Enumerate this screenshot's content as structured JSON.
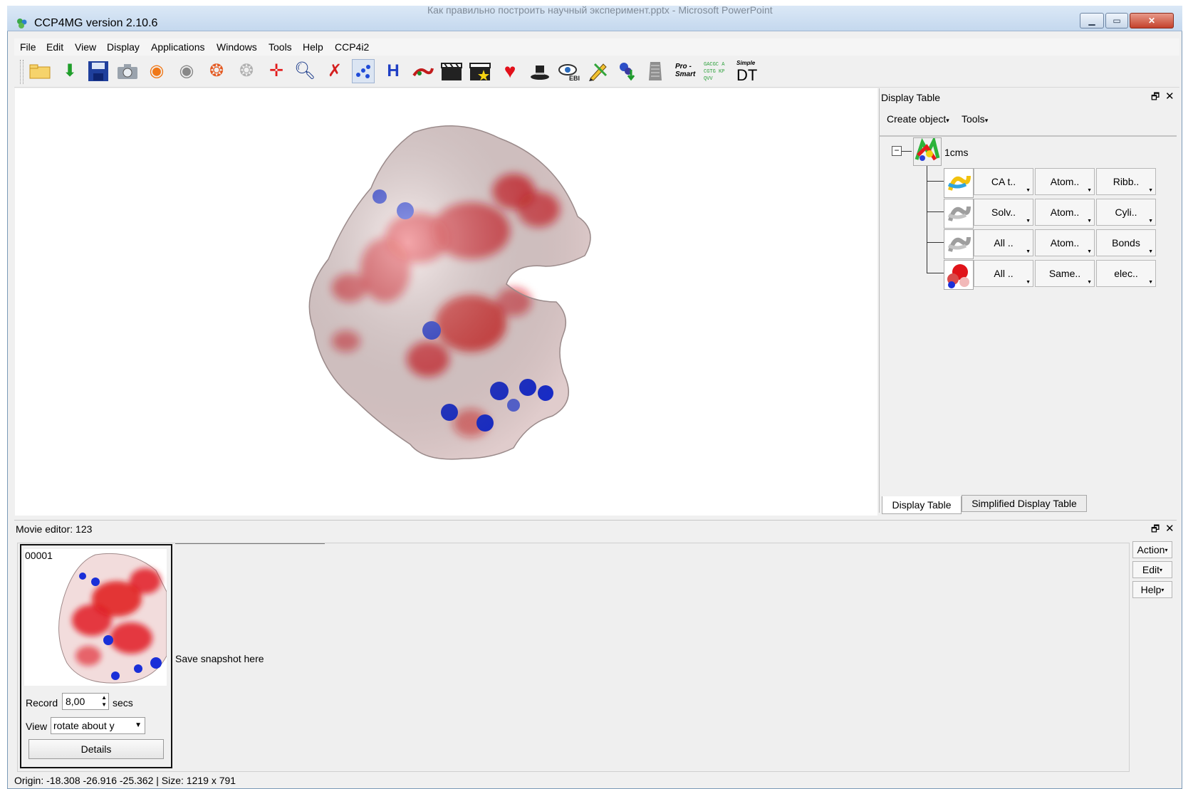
{
  "window": {
    "title": "CCP4MG version 2.10.6",
    "background_title": "Как правильно построить научный эксперимент.pptx - Microsoft PowerPoint",
    "accent_color": "#c4d8ee"
  },
  "menu": [
    "File",
    "Edit",
    "View",
    "Display",
    "Applications",
    "Windows",
    "Tools",
    "Help",
    "CCP4i2"
  ],
  "toolbar": {
    "icons": [
      "open-folder-icon",
      "download-icon",
      "save-icon",
      "camera-icon",
      "eye-orange-icon",
      "eye-grey-icon",
      "eye-color-icon",
      "eye-dim-icon",
      "centre-cross-icon",
      "zoom-search-icon",
      "no-atoms-icon",
      "select-points-icon",
      "measure-icon",
      "dragon-icon",
      "clapper-icon",
      "clapper-star-icon",
      "heart-icon",
      "wizard-hat-icon",
      "ebi-eye-icon",
      "pencil-icon",
      "download-molecule-icon",
      "document-icon"
    ],
    "pro_smart": "Pro - Smart",
    "sequence_label": "GACGC ACGTG KPQVV",
    "simple_dt_top": "Simple",
    "simple_dt_main": "DT"
  },
  "display_table": {
    "title": "Display Table",
    "menu": {
      "create": "Create object",
      "tools": "Tools"
    },
    "molecule": "1cms",
    "rows": [
      {
        "icon": "ribbon-colored-icon",
        "cells": [
          "CA t..",
          "Atom..",
          "Ribb.."
        ]
      },
      {
        "icon": "ribbon-grey-icon",
        "cells": [
          "Solv..",
          "Atom..",
          "Cyli.."
        ]
      },
      {
        "icon": "ribbon-grey-icon",
        "cells": [
          "All ..",
          "Atom..",
          "Bonds"
        ]
      },
      {
        "icon": "surface-electrostatic-icon",
        "cells": [
          "All ..",
          "Same..",
          "elec.."
        ]
      }
    ],
    "tabs": [
      "Display Table",
      "Simplified Display Table"
    ]
  },
  "movie_editor": {
    "title": "Movie editor: 123",
    "frame_number": "00001",
    "record_label": "Record",
    "record_value": "8,00",
    "record_unit": "secs",
    "view_label": "View",
    "view_value": "rotate about y",
    "details_label": "Details",
    "save_snapshot": "Save snapshot here",
    "actions": [
      "Action",
      "Edit",
      "Help"
    ]
  },
  "status": {
    "text": "Origin: -18.308 -26.916 -25.362 | Size: 1219 x 791"
  },
  "colors": {
    "surface_red": "#e0141a",
    "surface_blue": "#1a2fd8",
    "surface_white": "#f6eeee"
  }
}
